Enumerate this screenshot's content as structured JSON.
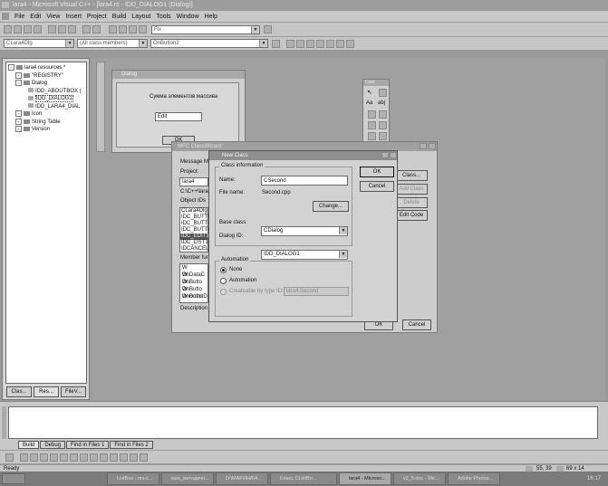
{
  "window": {
    "title": "lara4 - Microsoft Visual C++ - [lara4.rc - IDD_DIALOG1 (Dialog)]"
  },
  "menu": [
    "File",
    "Edit",
    "View",
    "Insert",
    "Project",
    "Build",
    "Layout",
    "Tools",
    "Window",
    "Help"
  ],
  "toolbar": {
    "find_value": "Fix"
  },
  "wizardbar": {
    "class_combo": "CLara4Dlg",
    "members_combo": "(All class members)",
    "function_combo": "OnButton2"
  },
  "resources": {
    "root": "lara4 resources *",
    "items": [
      "\"REGISTRY\"",
      "Dialog",
      "IDD_ABOUTBOX (",
      "IDD_DIALOG1",
      "IDD_LARA4_DIAL",
      "Icon",
      "String Table",
      "Version"
    ]
  },
  "bottom_tabs": [
    "Clas...",
    "Res...",
    "FileV..."
  ],
  "edit_dialog": {
    "title": "Dialog",
    "caption": "Сумма элементов массива",
    "edit_label": "Edit",
    "ok": "OK"
  },
  "controls_palette": {
    "title": "Cont"
  },
  "mfc_wizard": {
    "title": "MFC ClassWizard",
    "tab_label": "Message Ma",
    "project_label": "Project:",
    "project_value": "lara4",
    "path": "C:\\C++\\lara4",
    "object_ids_label": "Object IDs",
    "object_ids": [
      "CLara4Dlg",
      "IDC_BUTTO",
      "IDC_BUTTO",
      "IDC_BUTTO",
      "IDC_EDIT1",
      "IDC_LIST1",
      "IDCANCEL"
    ],
    "member_label": "Member func",
    "members": [
      "W  OnDataC",
      "W  OnButto",
      "W  OnButto",
      "W  OnButto",
      "W  OnInitD"
    ],
    "description_label": "Description",
    "right_buttons": [
      "Class...",
      "Add Class",
      "Delete Function",
      "Edit Code"
    ],
    "ok": "OK",
    "cancel": "Cancel"
  },
  "new_class": {
    "title": "New Class",
    "class_info_label": "Class information",
    "name_label": "Name:",
    "name_value": "CSecond",
    "file_label": "File name:",
    "file_value": "Second.cpp",
    "change_button": "Change...",
    "base_label": "Base class:",
    "base_value": "CDialog",
    "dialog_label": "Dialog ID:",
    "dialog_value": "IDD_DIALOG1",
    "automation_label": "Automation",
    "radio_none": "None",
    "radio_automation": "Automation",
    "radio_creatable": "Createable by type ID:",
    "type_id_value": "lara4.Second",
    "ok": "OK",
    "cancel": "Cancel"
  },
  "output_tabs": [
    "Build",
    "Debug",
    "Find in Files 1",
    "Find in Files 2"
  ],
  "status": {
    "text": "Ready",
    "coords": "55, 39",
    "size": "69 x 14"
  },
  "taskbar": [
    "ListBox - ms-c...",
    "мое_методичн...",
    "D:\\МАРИНА\\4...",
    "Класс CListBo...",
    "lara4 - Microso...",
    "v2_5.doc - Mic...",
    "Adobe Photos..."
  ],
  "clock": "16:17"
}
